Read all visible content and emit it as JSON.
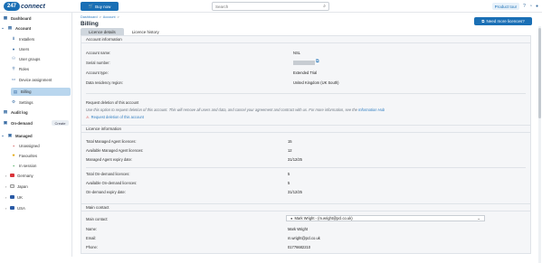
{
  "topbar": {
    "logo_num": "247",
    "logo_word": "connect",
    "buy_label": "Buy now",
    "search_placeholder": "Search",
    "product_tour": "Product tour"
  },
  "sidebar": {
    "dashboard": "Dashboard",
    "account": "Account",
    "installers": "Installers",
    "users": "Users",
    "user_groups": "User groups",
    "roles": "Roles",
    "device_assignment": "Device assignment",
    "billing": "Billing",
    "settings": "Settings",
    "audit_log": "Audit log",
    "on_demand": "On-demand",
    "create": "Create",
    "managed": "Managed",
    "unassigned": "Unassigned",
    "favourites": "Favourites",
    "in_session": "In session",
    "groups": [
      {
        "label": "Germany",
        "color": "#d9343a"
      },
      {
        "label": "Japan",
        "color": "#e4e4e4"
      },
      {
        "label": "UK",
        "color": "#2a5aa5"
      },
      {
        "label": "USA",
        "color": "#2a5aa5"
      }
    ]
  },
  "main": {
    "breadcrumb": [
      "Dashboard",
      ">",
      "Account",
      ">"
    ],
    "title": "Billing",
    "need_more": "Need more licences?",
    "tabs": [
      "Licence details",
      "Licence history"
    ],
    "account_info": {
      "header": "Account information",
      "rows": [
        {
          "label": "Account name:",
          "value": "NSL"
        },
        {
          "label": "Serial number:",
          "value": ""
        },
        {
          "label": "Account type:",
          "value": "Extended Trial"
        },
        {
          "label": "Data residency region:",
          "value": "United Kingdom (UK South)"
        }
      ],
      "deletion_title": "Request deletion of this account",
      "deletion_text": "Use this option to request deletion of this account. This will remove all users and data, and cancel your agreement and contract with us. For more information, see the",
      "deletion_link": "Information Hub",
      "deletion_action": "Request deletion of this account"
    },
    "licence_info": {
      "header": "Licence information",
      "rows": [
        {
          "label": "Total Managed Agent licences:",
          "value": "15"
        },
        {
          "label": "Available Managed Agent licences:",
          "value": "12"
        },
        {
          "label": "Managed Agent expiry date:",
          "value": "31/12/25"
        },
        {
          "label": "Total On-demand licences:",
          "value": "5"
        },
        {
          "label": "Available On-demand licences:",
          "value": "5"
        },
        {
          "label": "On-demand expiry date:",
          "value": "31/12/25"
        }
      ]
    },
    "main_contact": {
      "header": "Main contact",
      "select_label": "Main contact:",
      "select_value": "Mark Wright - (m.wright@pcl.co.uk)",
      "rows": [
        {
          "label": "Name:",
          "value": "Mark Wright"
        },
        {
          "label": "Email:",
          "value": "m.wright@pcl.co.uk"
        },
        {
          "label": "Phone:",
          "value": "01776682210"
        }
      ]
    }
  }
}
